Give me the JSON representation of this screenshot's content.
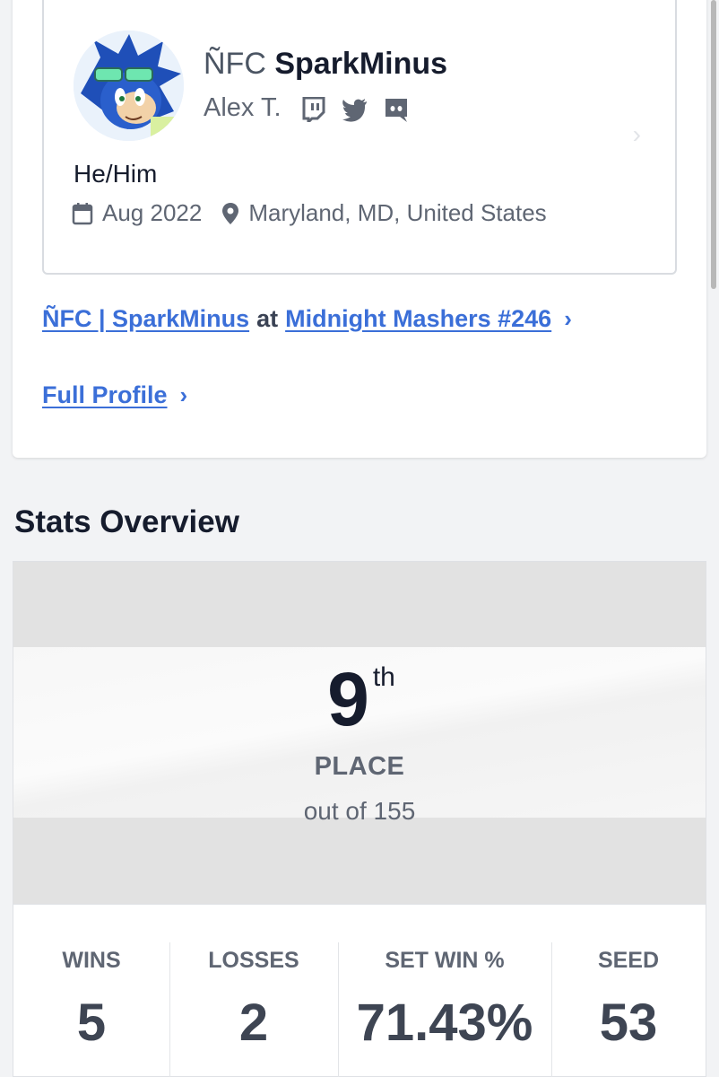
{
  "profile": {
    "prefix": "ÑFC",
    "gamer_tag": "SparkMinus",
    "real_name": "Alex T.",
    "pronouns": "He/Him",
    "joined": "Aug 2022",
    "location": "Maryland, MD, United States",
    "socials": [
      "twitch-icon",
      "twitter-icon",
      "discord-icon"
    ]
  },
  "links": {
    "entrant_team": "ÑFC | SparkMinus",
    "entrant_at": "at",
    "event": "Midnight Mashers #246",
    "full_profile": "Full Profile"
  },
  "stats": {
    "section_title": "Stats Overview",
    "place_number": "9",
    "place_suffix": "th",
    "place_label": "PLACE",
    "place_total": "out of 155",
    "columns": [
      {
        "label": "WINS",
        "value": "5"
      },
      {
        "label": "LOSSES",
        "value": "2"
      },
      {
        "label": "SET WIN %",
        "value": "71.43%"
      },
      {
        "label": "SEED",
        "value": "53"
      }
    ]
  },
  "colors": {
    "link": "#3b6fd8",
    "text_dark": "#161c2d",
    "text_muted": "#5f6673"
  }
}
